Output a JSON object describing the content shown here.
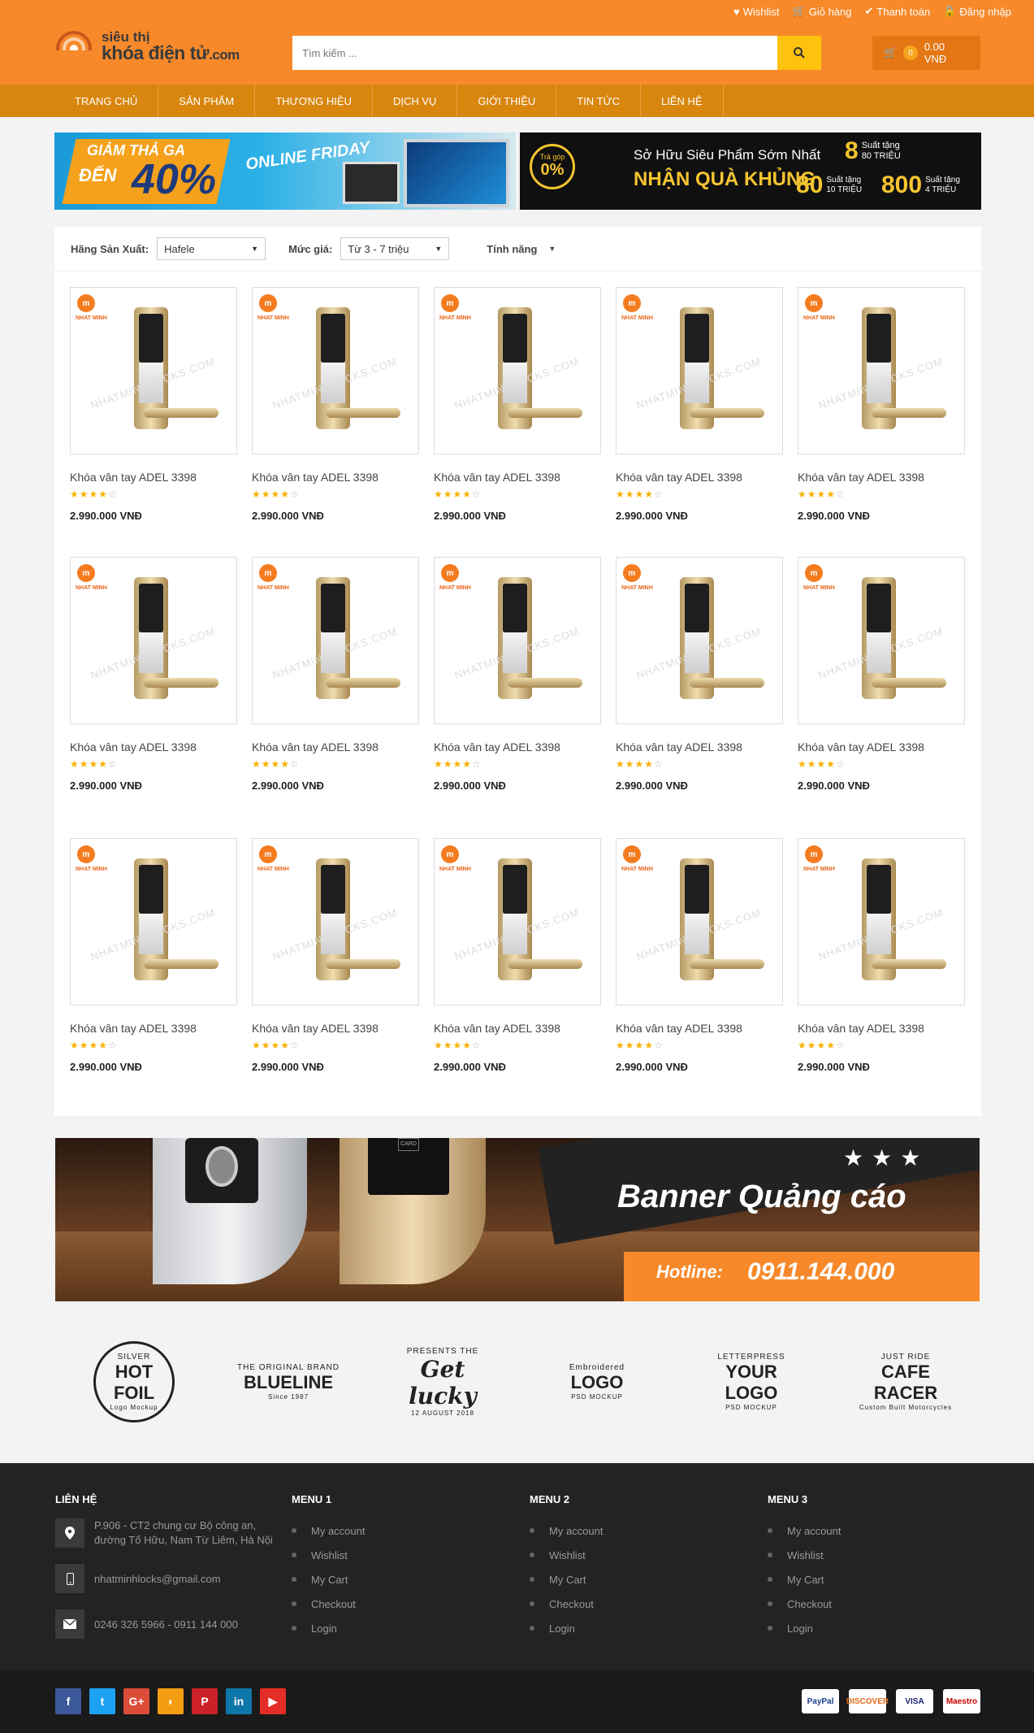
{
  "topbar": {
    "wishlist": "Wishlist",
    "cart": "Giỏ hàng",
    "checkout": "Thanh toán",
    "login": "Đăng nhập"
  },
  "logo": {
    "line1": "siêu thị",
    "line2": "khóa điện tử",
    "suffix": ".com"
  },
  "search": {
    "placeholder": "Tìm kiếm ...",
    "icon": "search-icon"
  },
  "cart": {
    "count": "0",
    "total": "0.00 VNĐ"
  },
  "nav": [
    "TRANG CHỦ",
    "SẢN PHẨM",
    "THƯƠNG HIỆU",
    "DỊCH VỤ",
    "GIỚI THIỆU",
    "TIN TỨC",
    "LIÊN HỆ"
  ],
  "banners": {
    "left": {
      "line1": "GIẢM THẢ GA",
      "line2": "ĐẾN",
      "percent": "40%",
      "tag": "ONLINE FRIDAY"
    },
    "right": {
      "badge_top": "Trả góp",
      "badge_value": "0%",
      "line1": "Sở Hữu Siêu Phẩm Sớm Nhất",
      "line2": "NHẬN QUÀ KHỦNG",
      "g1_num": "8",
      "g1_l1": "Suất tặng",
      "g1_l2": "80 TRIỆU",
      "g2_num": "80",
      "g2_l1": "Suất tặng",
      "g2_l2": "10 TRIỆU",
      "g3_num": "800",
      "g3_l1": "Suất tặng",
      "g3_l2": "4 TRIỆU"
    }
  },
  "filters": {
    "brand_label": "Hãng Sản Xuất:",
    "brand_value": "Hafele",
    "price_label": "Mức giá:",
    "price_value": "Từ 3 - 7 triệu",
    "feature_label": "Tính năng"
  },
  "product_logo": "NHAT MINH",
  "watermark": "NHATMINHLOCKS.COM",
  "products": [
    {
      "name": "Khóa vân tay ADEL 3398",
      "price": "2.990.000 VNĐ",
      "rating": 4
    },
    {
      "name": "Khóa vân tay ADEL 3398",
      "price": "2.990.000 VNĐ",
      "rating": 4
    },
    {
      "name": "Khóa vân tay ADEL 3398",
      "price": "2.990.000 VNĐ",
      "rating": 4
    },
    {
      "name": "Khóa vân tay ADEL 3398",
      "price": "2.990.000 VNĐ",
      "rating": 4
    },
    {
      "name": "Khóa vân tay ADEL 3398",
      "price": "2.990.000 VNĐ",
      "rating": 4
    },
    {
      "name": "Khóa vân tay ADEL 3398",
      "price": "2.990.000 VNĐ",
      "rating": 4
    },
    {
      "name": "Khóa vân tay ADEL 3398",
      "price": "2.990.000 VNĐ",
      "rating": 4
    },
    {
      "name": "Khóa vân tay ADEL 3398",
      "price": "2.990.000 VNĐ",
      "rating": 4
    },
    {
      "name": "Khóa vân tay ADEL 3398",
      "price": "2.990.000 VNĐ",
      "rating": 4
    },
    {
      "name": "Khóa vân tay ADEL 3398",
      "price": "2.990.000 VNĐ",
      "rating": 4
    },
    {
      "name": "Khóa vân tay ADEL 3398",
      "price": "2.990.000 VNĐ",
      "rating": 4
    },
    {
      "name": "Khóa vân tay ADEL 3398",
      "price": "2.990.000 VNĐ",
      "rating": 4
    },
    {
      "name": "Khóa vân tay ADEL 3398",
      "price": "2.990.000 VNĐ",
      "rating": 4
    },
    {
      "name": "Khóa vân tay ADEL 3398",
      "price": "2.990.000 VNĐ",
      "rating": 4
    },
    {
      "name": "Khóa vân tay ADEL 3398",
      "price": "2.990.000 VNĐ",
      "rating": 4
    }
  ],
  "ad": {
    "title": "Banner Quảng cáo",
    "hotline_label": "Hotline:",
    "hotline": "0911.144.000",
    "card": "CARD"
  },
  "brands": [
    {
      "top": "SILVER",
      "main": "HOT FOIL",
      "sub": "Logo Mockup"
    },
    {
      "top": "THE ORIGINAL BRAND",
      "main": "BLUELINE",
      "sub": "Since 1987"
    },
    {
      "top": "PRESENTS THE",
      "main": "Get lucky",
      "sub": "12 AUGUST 2018"
    },
    {
      "top": "Embroidered",
      "main": "LOGO",
      "sub": "PSD MOCKUP"
    },
    {
      "top": "LETTERPRESS",
      "main": "YOUR LOGO",
      "sub": "PSD MOCKUP"
    },
    {
      "top": "JUST RIDE",
      "main": "CAFE RACER",
      "sub": "Custom Built Motorcycles"
    }
  ],
  "footer": {
    "contact_title": "LIÊN HỆ",
    "address": "P.906 - CT2 chung cư Bộ công an, đường Tố Hữu, Nam Từ Liêm, Hà Nội",
    "email": "nhatminhlocks@gmail.com",
    "phone": "0246 326 5966 - 0911 144 000",
    "menus": [
      {
        "title": "MENU 1",
        "items": [
          "My account",
          "Wishlist",
          "My Cart",
          "Checkout",
          "Login"
        ]
      },
      {
        "title": "MENU 2",
        "items": [
          "My account",
          "Wishlist",
          "My Cart",
          "Checkout",
          "Login"
        ]
      },
      {
        "title": "MENU 3",
        "items": [
          "My account",
          "Wishlist",
          "My Cart",
          "Checkout",
          "Login"
        ]
      }
    ]
  },
  "social": [
    {
      "name": "facebook-icon",
      "glyph": "f",
      "color": "#3b5998"
    },
    {
      "name": "twitter-icon",
      "glyph": "t",
      "color": "#1da1f2"
    },
    {
      "name": "google-plus-icon",
      "glyph": "G+",
      "color": "#dd4b39"
    },
    {
      "name": "rss-icon",
      "glyph": "◗",
      "color": "#f39c12"
    },
    {
      "name": "pinterest-icon",
      "glyph": "P",
      "color": "#cb2027"
    },
    {
      "name": "linkedin-icon",
      "glyph": "in",
      "color": "#0e76a8"
    },
    {
      "name": "youtube-icon",
      "glyph": "▶",
      "color": "#e52d27"
    }
  ],
  "payments": [
    "PayPal",
    "DISCOVER",
    "VISA",
    "Maestro"
  ]
}
